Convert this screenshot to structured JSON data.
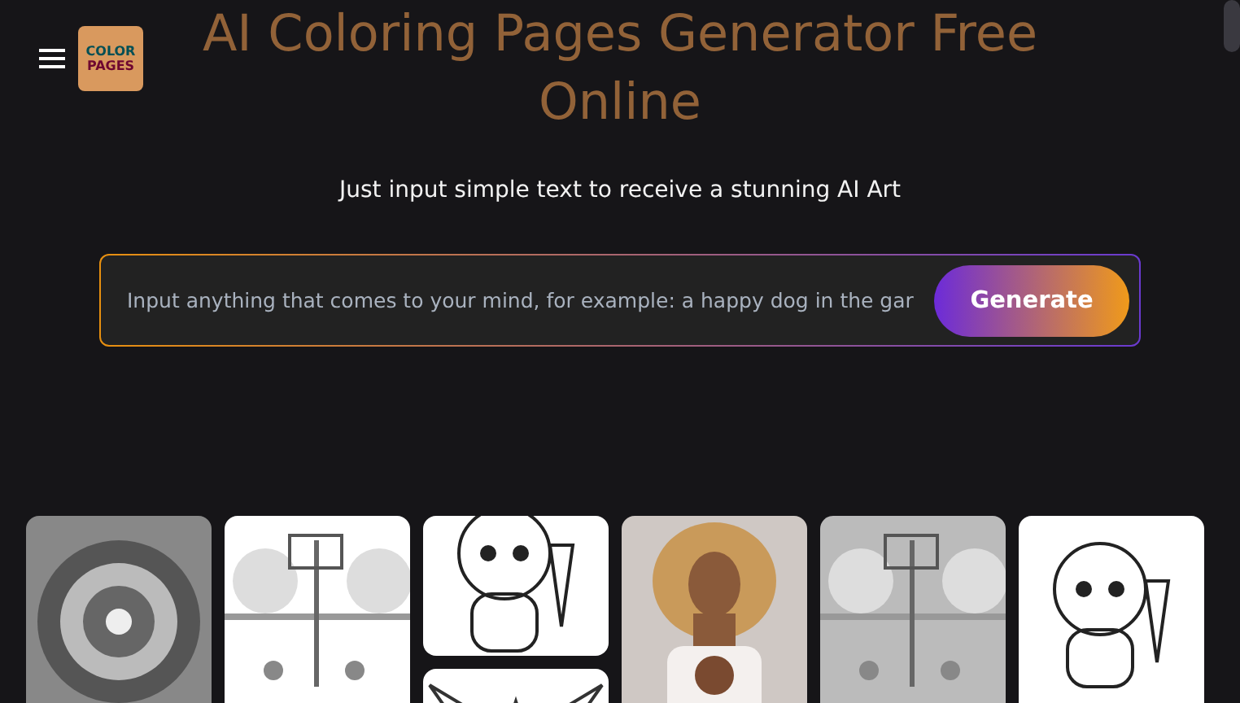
{
  "header": {
    "logo": [
      "COLOR",
      "PAGES"
    ]
  },
  "title": "AI Coloring Pages Generator Free Online",
  "subtitle": "Just input simple text to receive a stunning AI Art",
  "prompt": {
    "placeholder": "Input anything that comes to your mind, for example: a happy dog in the gar",
    "button": "Generate"
  }
}
